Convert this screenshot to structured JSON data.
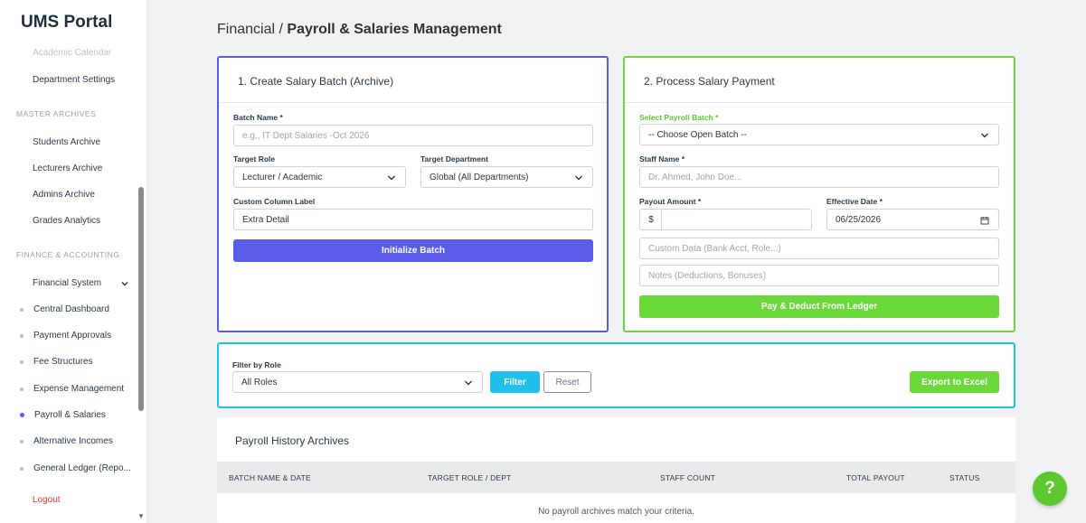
{
  "app": {
    "title": "UMS Portal"
  },
  "sidebar": {
    "faded_item": "Academic Calendar",
    "department_settings": "Department Settings",
    "master_archives": {
      "title": "MASTER ARCHIVES",
      "items": [
        "Students Archive",
        "Lecturers Archive",
        "Admins Archive",
        "Grades Analytics"
      ]
    },
    "finance": {
      "title": "FINANCE & ACCOUNTING",
      "group": "Financial System",
      "items": [
        "Central Dashboard",
        "Payment Approvals",
        "Fee Structures",
        "Expense Management",
        "Payroll & Salaries",
        "Alternative Incomes",
        "General Ledger (Repo..."
      ],
      "active_index": 4
    },
    "logout": "Logout"
  },
  "breadcrumb": {
    "parent": "Financial",
    "separator": "/",
    "current": "Payroll & Salaries Management"
  },
  "create_batch": {
    "title": "1. Create Salary Batch (Archive)",
    "batch_name_label": "Batch Name *",
    "batch_name_placeholder": "e.g., IT Dept Salaries -Oct 2026",
    "target_role_label": "Target Role",
    "target_role_value": "Lecturer / Academic",
    "target_dept_label": "Target Department",
    "target_dept_value": "Global (All Departments)",
    "custom_column_label": "Custom Column Label",
    "custom_column_value": "Extra Detail",
    "init_button": "Initialize Batch"
  },
  "process_payment": {
    "title": "2. Process Salary Payment",
    "select_batch_label": "Select Payroll Batch *",
    "select_batch_value": "-- Choose Open Batch --",
    "staff_name_label": "Staff Name *",
    "staff_name_placeholder": "Dr. Ahmed, John Doe...",
    "payout_amount_label": "Payout Amount *",
    "currency_symbol": "$",
    "effective_date_label": "Effective Date *",
    "effective_date_value": "06/25/2026",
    "custom_data_placeholder": "Custom Data (Bank Acct, Role...)",
    "notes_placeholder": "Notes (Deductions, Bonuses)",
    "pay_button": "Pay & Deduct From Ledger"
  },
  "filter": {
    "label": "Filter by Role",
    "value": "All Roles",
    "filter_button": "Filter",
    "reset_button": "Reset",
    "export_button": "Export to Excel"
  },
  "history": {
    "title": "Payroll History Archives",
    "columns": [
      "BATCH NAME & DATE",
      "TARGET ROLE / DEPT",
      "STAFF COUNT",
      "TOTAL PAYOUT",
      "STATUS"
    ],
    "empty_message": "No payroll archives match your criteria."
  },
  "help": {
    "label": "?"
  },
  "colors": {
    "primary": "#5a5ce8",
    "success": "#6cd93a",
    "info": "#1fc1e8",
    "danger": "#e53935"
  }
}
